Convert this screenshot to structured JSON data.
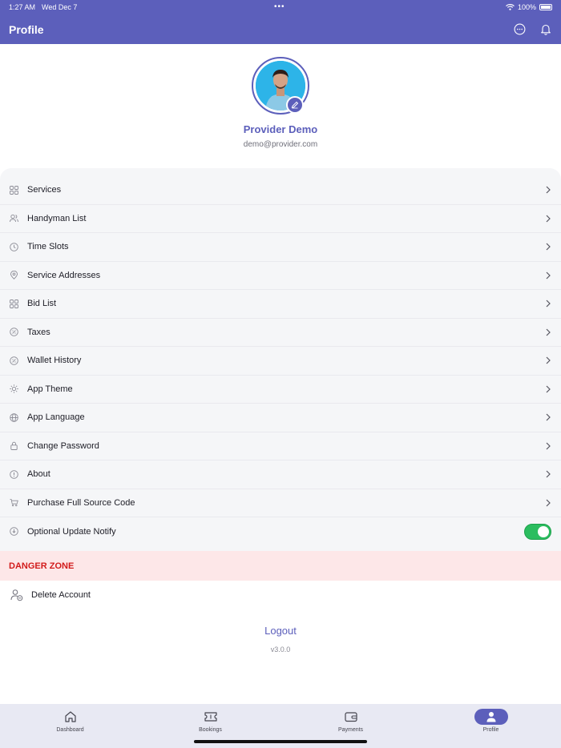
{
  "status_bar": {
    "time": "1:27 AM",
    "date": "Wed Dec 7",
    "dots": "•••",
    "battery": "100%"
  },
  "app_bar": {
    "title": "Profile",
    "icons": [
      "chat-icon",
      "bell-icon"
    ]
  },
  "profile": {
    "name": "Provider Demo",
    "email": "demo@provider.com"
  },
  "settings": [
    {
      "label": "Services",
      "icon": "grid-icon"
    },
    {
      "label": "Handyman List",
      "icon": "users-icon"
    },
    {
      "label": "Time Slots",
      "icon": "clock-icon"
    },
    {
      "label": "Service Addresses",
      "icon": "location-icon"
    },
    {
      "label": "Bid List",
      "icon": "grid-icon"
    },
    {
      "label": "Taxes",
      "icon": "percent-icon"
    },
    {
      "label": "Wallet History",
      "icon": "percent-icon"
    },
    {
      "label": "App Theme",
      "icon": "sun-icon"
    },
    {
      "label": "App Language",
      "icon": "globe-icon"
    },
    {
      "label": "Change Password",
      "icon": "lock-icon"
    },
    {
      "label": "About",
      "icon": "info-icon"
    },
    {
      "label": "Purchase Full Source Code",
      "icon": "cart-icon"
    },
    {
      "label": "Optional Update Notify",
      "icon": "download-icon",
      "toggle_on": true
    }
  ],
  "danger_zone": {
    "label": "DANGER ZONE",
    "delete_account": "Delete Account"
  },
  "logout": "Logout",
  "version": "v3.0.0",
  "bottom_nav": [
    {
      "label": "Dashboard",
      "icon": "home-icon",
      "active": false
    },
    {
      "label": "Bookings",
      "icon": "ticket-icon",
      "active": false
    },
    {
      "label": "Payments",
      "icon": "wallet-icon",
      "active": false
    },
    {
      "label": "Profile",
      "icon": "person-icon",
      "active": true
    }
  ],
  "colors": {
    "primary": "#5c5fbb",
    "danger": "#d21b1b",
    "danger_bg": "#fde7e8",
    "toggle": "#2bbd5f"
  }
}
